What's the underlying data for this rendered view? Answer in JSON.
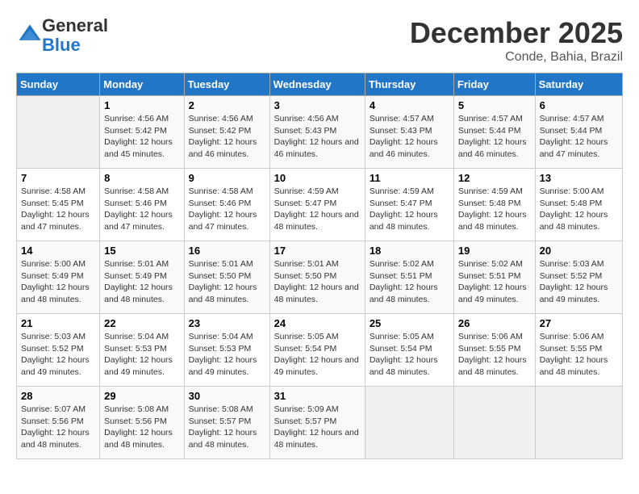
{
  "logo": {
    "general": "General",
    "blue": "Blue"
  },
  "title": "December 2025",
  "location": "Conde, Bahia, Brazil",
  "days_of_week": [
    "Sunday",
    "Monday",
    "Tuesday",
    "Wednesday",
    "Thursday",
    "Friday",
    "Saturday"
  ],
  "weeks": [
    [
      {
        "day": "",
        "sunrise": "",
        "sunset": "",
        "daylight": ""
      },
      {
        "day": "1",
        "sunrise": "4:56 AM",
        "sunset": "5:42 PM",
        "daylight": "12 hours and 45 minutes."
      },
      {
        "day": "2",
        "sunrise": "4:56 AM",
        "sunset": "5:42 PM",
        "daylight": "12 hours and 46 minutes."
      },
      {
        "day": "3",
        "sunrise": "4:56 AM",
        "sunset": "5:43 PM",
        "daylight": "12 hours and 46 minutes."
      },
      {
        "day": "4",
        "sunrise": "4:57 AM",
        "sunset": "5:43 PM",
        "daylight": "12 hours and 46 minutes."
      },
      {
        "day": "5",
        "sunrise": "4:57 AM",
        "sunset": "5:44 PM",
        "daylight": "12 hours and 46 minutes."
      },
      {
        "day": "6",
        "sunrise": "4:57 AM",
        "sunset": "5:44 PM",
        "daylight": "12 hours and 47 minutes."
      }
    ],
    [
      {
        "day": "7",
        "sunrise": "4:58 AM",
        "sunset": "5:45 PM",
        "daylight": "12 hours and 47 minutes."
      },
      {
        "day": "8",
        "sunrise": "4:58 AM",
        "sunset": "5:46 PM",
        "daylight": "12 hours and 47 minutes."
      },
      {
        "day": "9",
        "sunrise": "4:58 AM",
        "sunset": "5:46 PM",
        "daylight": "12 hours and 47 minutes."
      },
      {
        "day": "10",
        "sunrise": "4:59 AM",
        "sunset": "5:47 PM",
        "daylight": "12 hours and 48 minutes."
      },
      {
        "day": "11",
        "sunrise": "4:59 AM",
        "sunset": "5:47 PM",
        "daylight": "12 hours and 48 minutes."
      },
      {
        "day": "12",
        "sunrise": "4:59 AM",
        "sunset": "5:48 PM",
        "daylight": "12 hours and 48 minutes."
      },
      {
        "day": "13",
        "sunrise": "5:00 AM",
        "sunset": "5:48 PM",
        "daylight": "12 hours and 48 minutes."
      }
    ],
    [
      {
        "day": "14",
        "sunrise": "5:00 AM",
        "sunset": "5:49 PM",
        "daylight": "12 hours and 48 minutes."
      },
      {
        "day": "15",
        "sunrise": "5:01 AM",
        "sunset": "5:49 PM",
        "daylight": "12 hours and 48 minutes."
      },
      {
        "day": "16",
        "sunrise": "5:01 AM",
        "sunset": "5:50 PM",
        "daylight": "12 hours and 48 minutes."
      },
      {
        "day": "17",
        "sunrise": "5:01 AM",
        "sunset": "5:50 PM",
        "daylight": "12 hours and 48 minutes."
      },
      {
        "day": "18",
        "sunrise": "5:02 AM",
        "sunset": "5:51 PM",
        "daylight": "12 hours and 48 minutes."
      },
      {
        "day": "19",
        "sunrise": "5:02 AM",
        "sunset": "5:51 PM",
        "daylight": "12 hours and 49 minutes."
      },
      {
        "day": "20",
        "sunrise": "5:03 AM",
        "sunset": "5:52 PM",
        "daylight": "12 hours and 49 minutes."
      }
    ],
    [
      {
        "day": "21",
        "sunrise": "5:03 AM",
        "sunset": "5:52 PM",
        "daylight": "12 hours and 49 minutes."
      },
      {
        "day": "22",
        "sunrise": "5:04 AM",
        "sunset": "5:53 PM",
        "daylight": "12 hours and 49 minutes."
      },
      {
        "day": "23",
        "sunrise": "5:04 AM",
        "sunset": "5:53 PM",
        "daylight": "12 hours and 49 minutes."
      },
      {
        "day": "24",
        "sunrise": "5:05 AM",
        "sunset": "5:54 PM",
        "daylight": "12 hours and 49 minutes."
      },
      {
        "day": "25",
        "sunrise": "5:05 AM",
        "sunset": "5:54 PM",
        "daylight": "12 hours and 48 minutes."
      },
      {
        "day": "26",
        "sunrise": "5:06 AM",
        "sunset": "5:55 PM",
        "daylight": "12 hours and 48 minutes."
      },
      {
        "day": "27",
        "sunrise": "5:06 AM",
        "sunset": "5:55 PM",
        "daylight": "12 hours and 48 minutes."
      }
    ],
    [
      {
        "day": "28",
        "sunrise": "5:07 AM",
        "sunset": "5:56 PM",
        "daylight": "12 hours and 48 minutes."
      },
      {
        "day": "29",
        "sunrise": "5:08 AM",
        "sunset": "5:56 PM",
        "daylight": "12 hours and 48 minutes."
      },
      {
        "day": "30",
        "sunrise": "5:08 AM",
        "sunset": "5:57 PM",
        "daylight": "12 hours and 48 minutes."
      },
      {
        "day": "31",
        "sunrise": "5:09 AM",
        "sunset": "5:57 PM",
        "daylight": "12 hours and 48 minutes."
      },
      {
        "day": "",
        "sunrise": "",
        "sunset": "",
        "daylight": ""
      },
      {
        "day": "",
        "sunrise": "",
        "sunset": "",
        "daylight": ""
      },
      {
        "day": "",
        "sunrise": "",
        "sunset": "",
        "daylight": ""
      }
    ]
  ]
}
